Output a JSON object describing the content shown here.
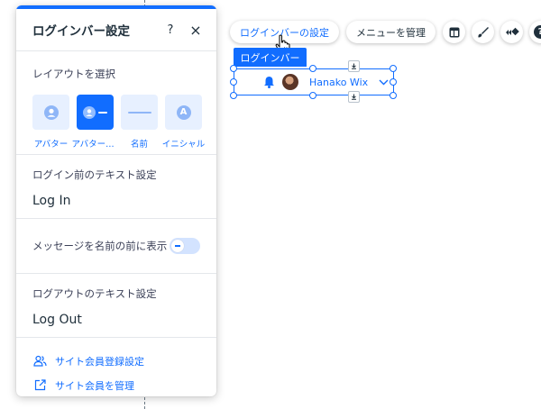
{
  "panel": {
    "title": "ログインバー設定",
    "help_icon": "?",
    "close_icon": "×",
    "layout_label": "レイアウトを選択",
    "layouts": [
      {
        "label": "アバター",
        "icon": "avatar-icon"
      },
      {
        "label": "アバター＆名前",
        "icon": "avatar-name-icon"
      },
      {
        "label": "名前",
        "icon": "name-line-icon"
      },
      {
        "label": "イニシャル",
        "icon": "initial-icon",
        "glyph": "A"
      }
    ],
    "selected_layout": "アバター＆名前",
    "login_label": "ログイン前のテキスト設定",
    "login_text": "Log In",
    "message_label": "メッセージを名前の前に表示",
    "message_toggle": "off",
    "logout_label": "ログアウトのテキスト設定",
    "logout_text": "Log Out",
    "links": [
      {
        "label": "サイト会員登録設定",
        "icon": "members-icon"
      },
      {
        "label": "サイト会員を管理",
        "icon": "external-link-icon"
      }
    ]
  },
  "toolbar": {
    "settings_button": "ログインバーの設定",
    "manage_menu_button": "メニューを管理",
    "icons": [
      "layout-icon",
      "design-brush-icon",
      "animation-icon",
      "help-icon"
    ],
    "help_glyph": "?"
  },
  "element": {
    "tag": "ログインバー",
    "user_name": "Hanako Wix"
  },
  "colors": {
    "accent": "#116dff",
    "accent_light": "#e7f0ff",
    "text": "#20303c"
  }
}
